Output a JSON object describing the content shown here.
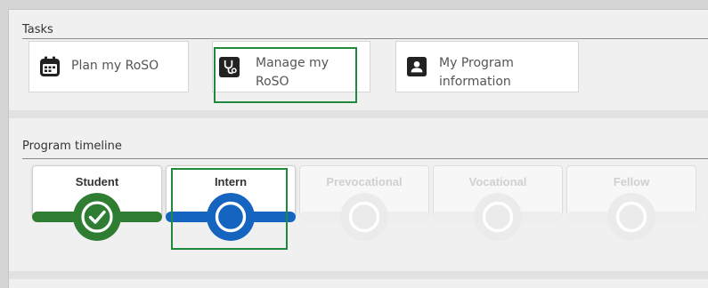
{
  "tasks": {
    "title": "Tasks",
    "items": [
      {
        "label": "Plan my RoSO",
        "icon": "calendar-icon"
      },
      {
        "label_line1": "Manage my",
        "label_line2": "RoSO",
        "icon": "stethoscope-icon"
      },
      {
        "label_line1": "My Program",
        "label_line2": "information",
        "icon": "contact-card-icon"
      }
    ]
  },
  "timeline": {
    "title": "Program timeline",
    "stages": [
      {
        "label": "Student",
        "status": "completed",
        "color": "#2e7d32"
      },
      {
        "label": "Intern",
        "status": "current",
        "color": "#1565c0"
      },
      {
        "label": "Prevocational",
        "status": "future"
      },
      {
        "label": "Vocational",
        "status": "future"
      },
      {
        "label": "Fellow",
        "status": "future"
      }
    ]
  },
  "colors": {
    "highlight": "#1f8a3c",
    "completed": "#2e7d32",
    "current": "#1565c0",
    "future": "#ebebeb"
  }
}
